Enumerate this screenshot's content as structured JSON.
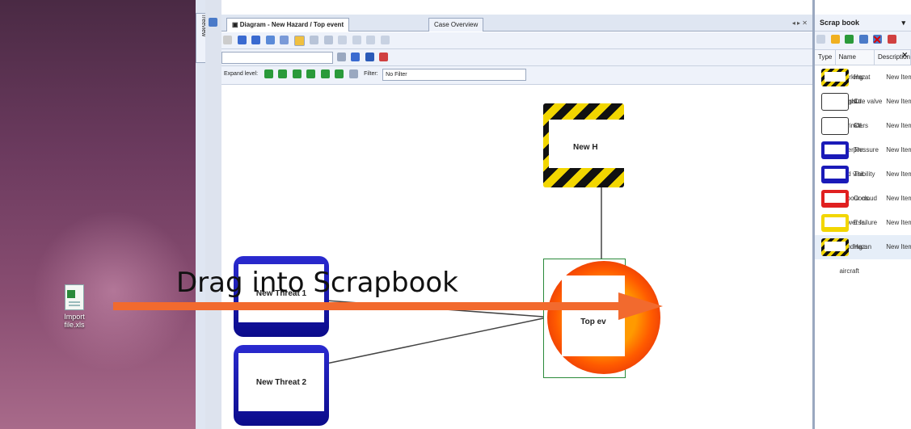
{
  "desktop": {
    "file_icon": "excel-file-icon",
    "file_label_line1": "Import",
    "file_label_line2": "file.xls"
  },
  "side_panel": {
    "vertical_tab": "Treeview"
  },
  "document": {
    "tabs": [
      {
        "label": "Diagram - New Hazard / Top event",
        "active": true,
        "icon": "diagram-icon"
      },
      {
        "label": "Case Overview",
        "active": false
      }
    ],
    "tab_controls": "◂ ▸ ✕",
    "expand_level_label": "Expand level:",
    "filter_label": "Filter:",
    "filter_value": "No Filter"
  },
  "diagram": {
    "hazard_label": "New H",
    "threat1_label": "New Threat 1",
    "threat2_label": "New Threat 2",
    "top_event_label": "Top ev",
    "colors": {
      "hazard_yellow": "#f2d600",
      "threat_blue": "#1a1ab8",
      "top_event_orange": "#ff6a00"
    }
  },
  "scrapbook": {
    "title": "Scrap book",
    "title_controls": "▾ ⊕ ✕",
    "columns": [
      "Type",
      "Name",
      "Description"
    ],
    "rows": [
      {
        "type": "Haz.",
        "name": "Working at height",
        "description": "New Item Descr",
        "thumb": "hazard"
      },
      {
        "type": "Ctl.",
        "name": "Pressure valve",
        "description": "New Item Descr",
        "thumb": "control"
      },
      {
        "type": "Ctl.",
        "name": "Sprinklers",
        "description": "New Item Descr",
        "thumb": "control"
      },
      {
        "type": "Thr.",
        "name": "Overpressure",
        "description": "New Item Descr",
        "thumb": "threat"
      },
      {
        "type": "Thr.",
        "name": "Bad visibility",
        "description": "New Item Descr",
        "thumb": "threat"
      },
      {
        "type": "Cons.",
        "name": "Vapour cloud",
        "description": "New Item Descr",
        "thumb": "consequence"
      },
      {
        "type": "Esc.",
        "name": "Power failure",
        "description": "New Item Descr",
        "thumb": "escalation"
      },
      {
        "type": "Haz.",
        "name": "Landing an aircraft",
        "description": "New Item Descr",
        "thumb": "hazard",
        "selected": true
      }
    ]
  },
  "annotation": {
    "text": "Drag into Scrapbook",
    "arrow_color": "#f26a2e"
  }
}
